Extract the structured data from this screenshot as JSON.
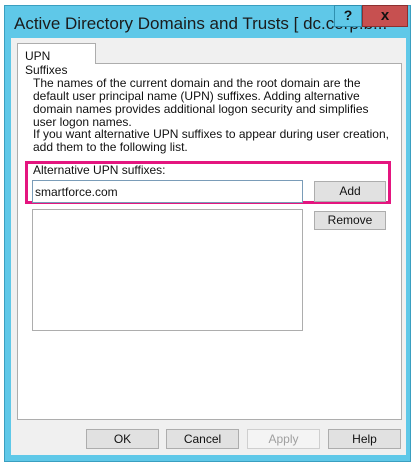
{
  "window": {
    "title": "Active Directory Domains and Trusts [ dc.corp.b...",
    "help_glyph": "?",
    "close_glyph": "x"
  },
  "tabs": [
    {
      "label": "UPN Suffixes",
      "active": true
    }
  ],
  "upn": {
    "description1": "The names of the current domain and the root domain are the default user principal name (UPN) suffixes. Adding alternative domain names provides additional logon security and simplifies user logon names.",
    "description2": "If you want alternative UPN suffixes to appear during user creation, add them to the following list.",
    "alt_label": "Alternative UPN suffixes:",
    "input_value": "smartforce.com",
    "add_label": "Add",
    "remove_label": "Remove",
    "suffix_list": []
  },
  "footer": {
    "ok": "OK",
    "cancel": "Cancel",
    "apply": "Apply",
    "help": "Help"
  },
  "colors": {
    "highlight": "#e4157f",
    "titlebar": "#5fc8e8",
    "close": "#c75050"
  }
}
